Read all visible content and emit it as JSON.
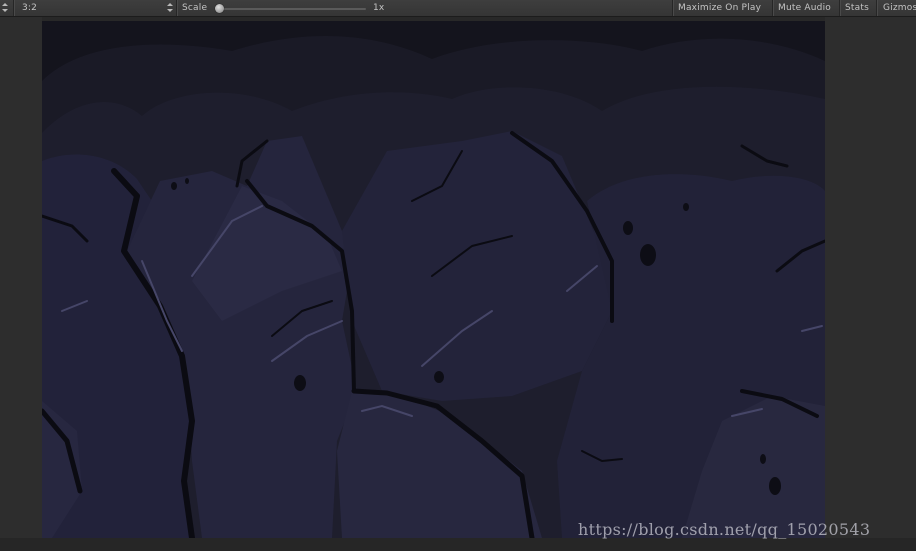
{
  "toolbar": {
    "aspect_label": "3:2",
    "scale_label": "Scale",
    "scale_value": "1x",
    "scale_slider_value": 0.0,
    "maximize_on_play": "Maximize On Play",
    "mute_audio": "Mute Audio",
    "stats": "Stats",
    "gizmos": "Gizmos"
  },
  "game_view": {
    "scene": "dark cave rock background",
    "palette": {
      "sky": "#14141d",
      "far_rock": "#1b1b27",
      "mid_rock": "#202030",
      "rock": "#24243a",
      "rock_light": "#2c2c46",
      "crack": "#0b0b12",
      "highlight": "#4a4a6e"
    }
  },
  "watermark": {
    "text": "https://blog.csdn.net/qq_15020543"
  }
}
